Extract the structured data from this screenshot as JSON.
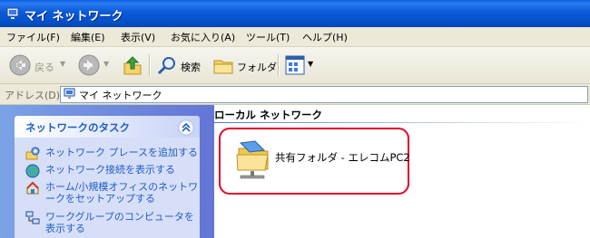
{
  "window": {
    "title": "マイ ネットワーク"
  },
  "menu": {
    "items": [
      "ファイル(F)",
      "編集(E)",
      "表示(V)",
      "お気に入り(A)",
      "ツール(T)",
      "ヘルプ(H)"
    ]
  },
  "toolbar": {
    "back_label": "戻る",
    "search_label": "検索",
    "folders_label": "フォルダ"
  },
  "address": {
    "label": "アドレス(D)",
    "value": "マイ ネットワーク"
  },
  "tasks": {
    "title": "ネットワークのタスク",
    "items": [
      "ネットワーク プレースを追加する",
      "ネットワーク接続を表示する",
      "ホーム/小規模オフィスのネットワークをセットアップする",
      "ワークグループのコンピュータを表示する"
    ]
  },
  "content": {
    "group_title": "ローカル ネットワーク",
    "items": [
      {
        "label": "共有フォルダ - エレコムPC2"
      }
    ]
  },
  "colors": {
    "titlebar": "#0a5ad8",
    "task_link": "#215dc6",
    "highlight_border": "#e0002a"
  }
}
